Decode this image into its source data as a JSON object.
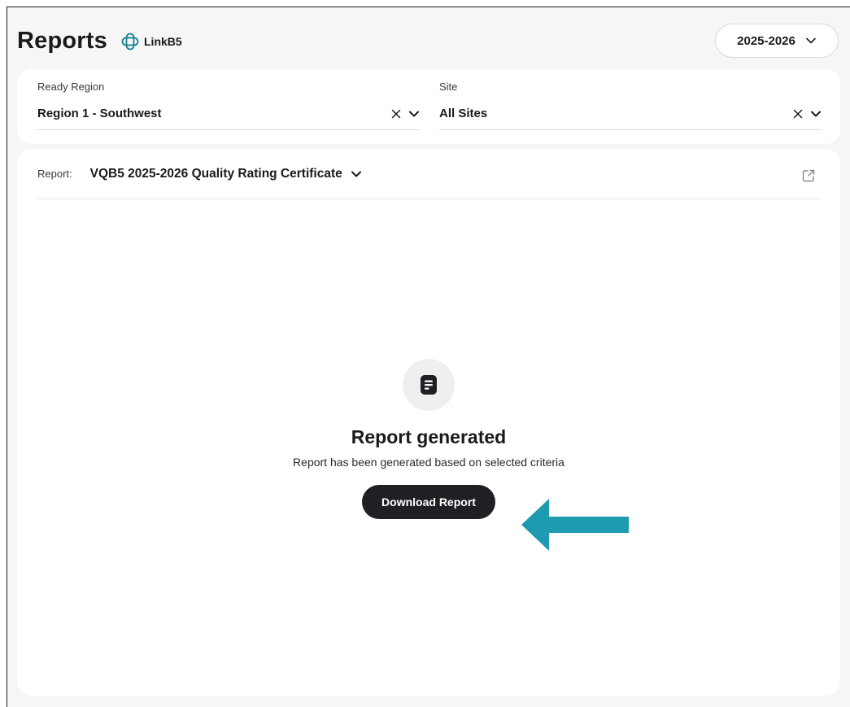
{
  "header": {
    "title": "Reports",
    "brand": "LinkB5",
    "year_select": "2025-2026"
  },
  "filters": {
    "region": {
      "label": "Ready Region",
      "value": "Region 1 - Southwest"
    },
    "site": {
      "label": "Site",
      "value": "All Sites"
    }
  },
  "report": {
    "prefix": "Report:",
    "name": "VQB5 2025-2026 Quality Rating Certificate"
  },
  "result": {
    "title": "Report generated",
    "description": "Report has been generated based on selected criteria",
    "download_label": "Download Report"
  },
  "colors": {
    "accent_arrow": "#1f9bb0",
    "button_dark": "#1e2023",
    "brand_icon": "#1a7f8c"
  },
  "icons": {
    "brand": "linkb5-logo-icon",
    "year_chevron": "chevron-down-icon",
    "clear": "close-icon",
    "dropdown": "chevron-down-icon",
    "external": "external-link-icon",
    "document": "document-icon",
    "annotation": "arrow-left-icon"
  }
}
